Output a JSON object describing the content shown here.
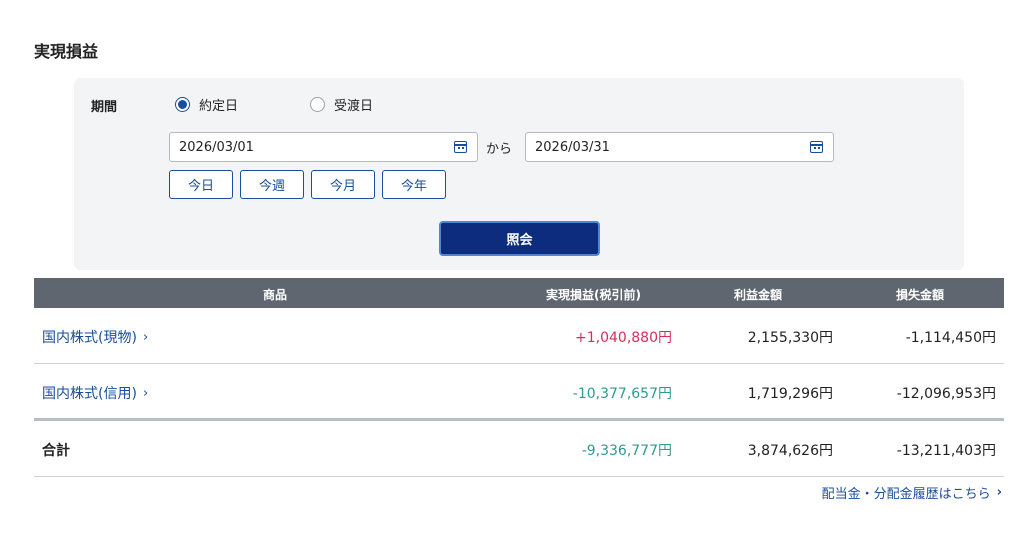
{
  "page": {
    "title": "実現損益"
  },
  "search": {
    "period_label": "期間",
    "radio_yakujo": "約定日",
    "radio_ukewatashi": "受渡日",
    "selected": "yakujo",
    "date_from": "2026/03/01",
    "date_separator": "から",
    "date_to": "2026/03/31",
    "quick": {
      "today": "今日",
      "week": "今週",
      "month": "今月",
      "year": "今年"
    },
    "submit": "照会"
  },
  "table": {
    "headers": {
      "product": "商品",
      "realized": "実現損益(税引前)",
      "profit": "利益金額",
      "loss": "損失金額"
    },
    "rows": [
      {
        "name": "国内株式(現物)",
        "realized": "+1,040,880円",
        "profit": "2,155,330円",
        "loss": "-1,114,450円"
      },
      {
        "name": "国内株式(信用)",
        "realized": "-10,377,657円",
        "profit": "1,719,296円",
        "loss": "-12,096,953円"
      }
    ],
    "total": {
      "name": "合計",
      "realized": "-9,336,777円",
      "profit": "3,874,626円",
      "loss": "-13,211,403円"
    }
  },
  "footer": {
    "dividend_link": "配当金・分配金履歴はこちら"
  },
  "colors": {
    "accent": "#1a4d9c",
    "button_bg": "#0e2c7d",
    "positive": "#d62e5a",
    "negative": "#2f9a8f",
    "header_bg": "#5f6670"
  }
}
